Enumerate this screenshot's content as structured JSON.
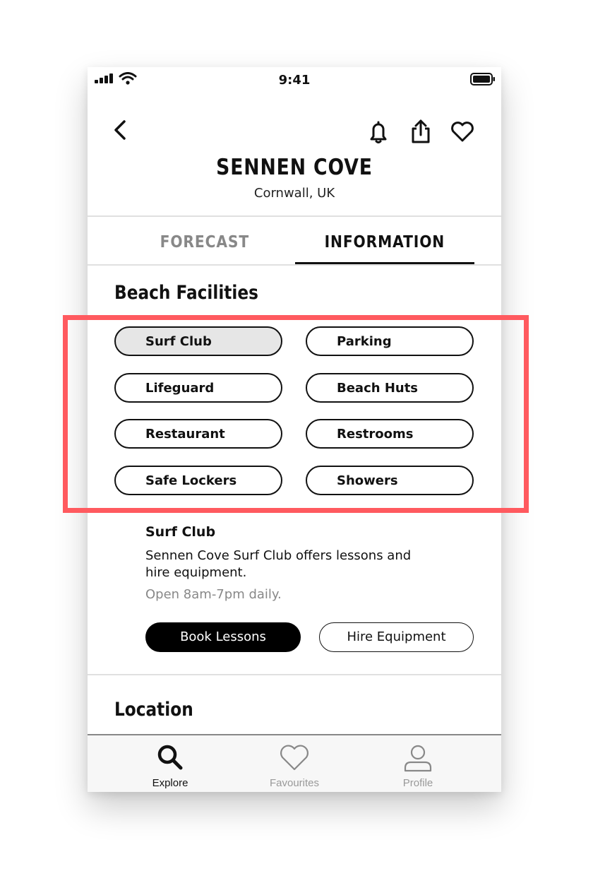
{
  "status_bar": {
    "time": "9:41"
  },
  "header": {
    "title": "SENNEN COVE",
    "subtitle": "Cornwall, UK"
  },
  "tabs": [
    {
      "label": "FORECAST",
      "active": false
    },
    {
      "label": "INFORMATION",
      "active": true
    }
  ],
  "facilities": {
    "heading": "Beach Facilities",
    "items": [
      {
        "label": "Surf Club",
        "selected": true
      },
      {
        "label": "Parking",
        "selected": false
      },
      {
        "label": "Lifeguard",
        "selected": false
      },
      {
        "label": "Beach Huts",
        "selected": false
      },
      {
        "label": "Restaurant",
        "selected": false
      },
      {
        "label": "Restrooms",
        "selected": false
      },
      {
        "label": "Safe Lockers",
        "selected": false
      },
      {
        "label": "Showers",
        "selected": false
      }
    ],
    "highlight_color": "#ff5a5f"
  },
  "detail": {
    "title": "Surf Club",
    "description": "Sennen Cove Surf Club offers lessons and hire equipment.",
    "hours": "Open 8am-7pm daily.",
    "primary_button": "Book Lessons",
    "secondary_button": "Hire Equipment"
  },
  "location": {
    "heading": "Location"
  },
  "bottom_nav": [
    {
      "label": "Explore",
      "icon": "search-icon",
      "active": true
    },
    {
      "label": "Favourites",
      "icon": "heart-icon",
      "active": false
    },
    {
      "label": "Profile",
      "icon": "profile-icon",
      "active": false
    }
  ],
  "icons": {
    "back": "back-arrow-icon",
    "notifications": "bell-icon",
    "share": "share-icon",
    "favourite": "heart-icon"
  },
  "colors": {
    "accent": "#000000",
    "inactive": "#888888",
    "chip_selected_bg": "#e6e6e6"
  }
}
